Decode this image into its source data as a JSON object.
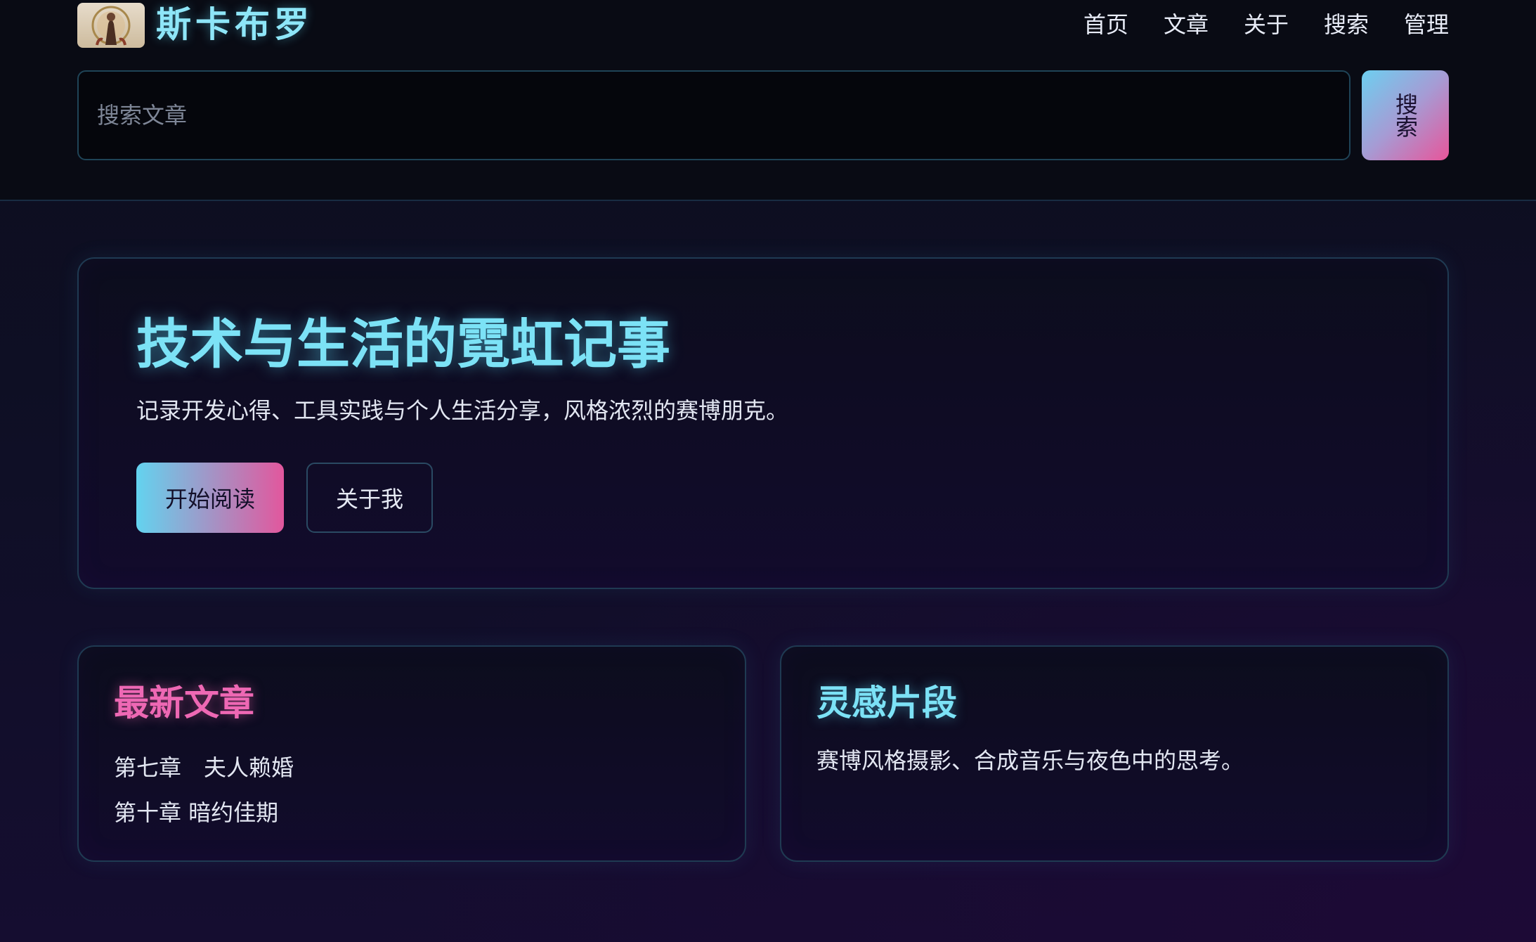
{
  "header": {
    "site_title": "斯卡布罗",
    "nav": [
      "首页",
      "文章",
      "关于",
      "搜索",
      "管理"
    ],
    "search": {
      "placeholder": "搜索文章",
      "value": "",
      "button_label": "搜索"
    }
  },
  "hero": {
    "title": "技术与生活的霓虹记事",
    "subtitle": "记录开发心得、工具实践与个人生活分享，风格浓烈的赛博朋克。",
    "primary_button": "开始阅读",
    "secondary_button": "关于我"
  },
  "latest_articles": {
    "title": "最新文章",
    "items": [
      "第七章　夫人赖婚",
      "第十章 暗约佳期"
    ]
  },
  "inspiration": {
    "title": "灵感片段",
    "text": "赛博风格摄影、合成音乐与夜色中的思考。"
  },
  "colors": {
    "accent_cyan": "#7ce2f6",
    "accent_pink": "#ee68b4",
    "background": "#0f0f26"
  }
}
